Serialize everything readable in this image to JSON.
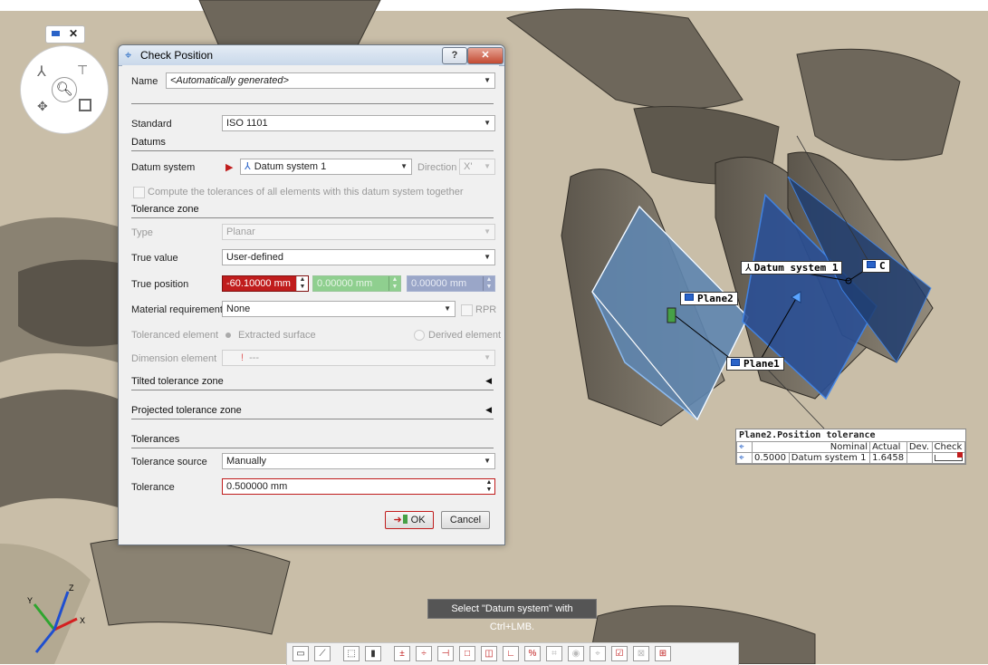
{
  "dialog": {
    "title": "Check Position",
    "name_label": "Name",
    "name_value": "<Automatically generated>",
    "standard_label": "Standard",
    "standard_value": "ISO 1101",
    "datums_section": "Datums",
    "datum_system_label": "Datum system",
    "datum_system_value": "Datum system 1",
    "direction_label": "Direction",
    "direction_value": "X'",
    "compute_checkbox_label": "Compute the tolerances of all elements with this datum system together",
    "tolerance_zone_section": "Tolerance zone",
    "type_label": "Type",
    "type_value": "Planar",
    "true_value_label": "True value",
    "true_value_value": "User-defined",
    "true_position_label": "True position",
    "true_position_x": "-60.10000 mm",
    "true_position_y": "0.00000 mm",
    "true_position_z": "0.00000 mm",
    "material_requirement_label": "Material requirement",
    "material_requirement_value": "None",
    "rpr_label": "RPR",
    "toleranced_element_label": "Toleranced element",
    "extracted_surface_label": "Extracted surface",
    "derived_element_label": "Derived element",
    "dimension_element_label": "Dimension element",
    "dimension_element_value": "---",
    "tilted_section": "Tilted tolerance zone",
    "projected_section": "Projected tolerance zone",
    "tolerances_section": "Tolerances",
    "tolerance_source_label": "Tolerance source",
    "tolerance_source_value": "Manually",
    "tolerance_label": "Tolerance",
    "tolerance_value": "0.500000 mm",
    "ok_label": "OK",
    "cancel_label": "Cancel",
    "help_label": "?"
  },
  "scene_labels": {
    "datum_system": "Datum system 1",
    "c": "C",
    "plane2": "Plane2",
    "plane1": "Plane1"
  },
  "result_table": {
    "title": "Plane2.Position tolerance",
    "headers": [
      "",
      "",
      "Nominal",
      "Actual",
      "Dev.",
      "Check"
    ],
    "row": {
      "tol": "0.5000",
      "datum": "Datum system 1",
      "actual": "1.6458",
      "dev": ""
    }
  },
  "hint": "Select \"Datum system\" with Ctrl+LMB.",
  "axes": {
    "x": "X",
    "y": "Y",
    "z": "Z"
  },
  "colors": {
    "accent_blue": "#2a63c8",
    "error_red": "#c01d1d",
    "ok_green": "#46a046",
    "model": "#c9bea8"
  }
}
